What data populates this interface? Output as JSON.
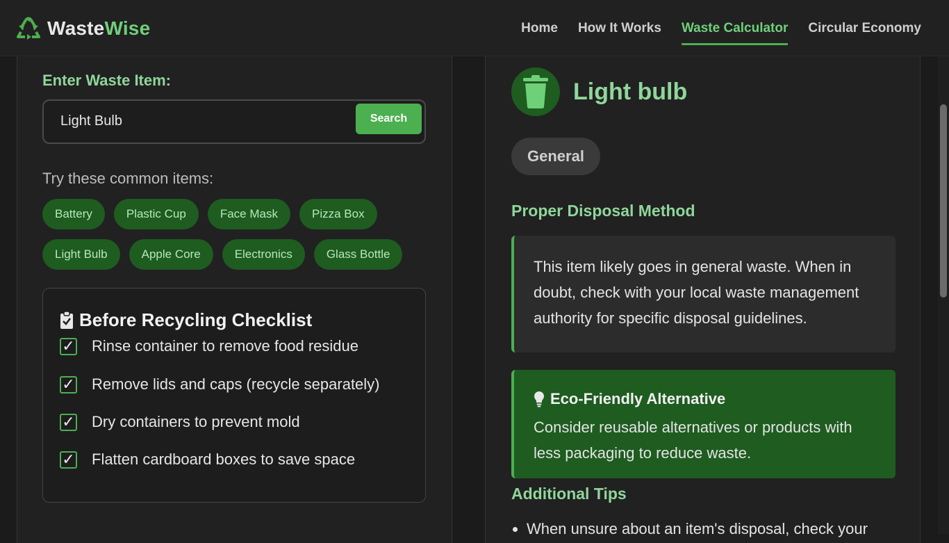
{
  "brand": {
    "name_part1": "Waste",
    "name_part2": "Wise"
  },
  "nav": {
    "items": [
      "Home",
      "How It Works",
      "Waste Calculator",
      "Circular Economy"
    ],
    "active": "Waste Calculator"
  },
  "search": {
    "label": "Enter Waste Item:",
    "value": "Light Bulb",
    "button": "Search"
  },
  "common": {
    "label": "Try these common items:",
    "rows": [
      [
        "Battery",
        "Plastic Cup",
        "Face Mask",
        "Pizza Box"
      ],
      [
        "Light Bulb",
        "Apple Core",
        "Electronics",
        "Glass Bottle"
      ]
    ]
  },
  "checklist": {
    "title": "Before Recycling Checklist",
    "check_mark": "✓",
    "items": [
      "Rinse container to remove food residue",
      "Remove lids and caps (recycle separately)",
      "Dry containers to prevent mold",
      "Flatten cardboard boxes to save space"
    ]
  },
  "result": {
    "title": "Light bulb",
    "category": "General",
    "disposal_heading": "Proper Disposal Method",
    "disposal_text": "This item likely goes in general waste. When in doubt, check with your local waste management authority for specific disposal guidelines.",
    "eco_title": "Eco-Friendly Alternative",
    "eco_text": "Consider reusable alternatives or products with less packaging to reduce waste.",
    "tips_heading": "Additional Tips",
    "tips": [
      "When unsure about an item's disposal, check your"
    ]
  },
  "icons": {
    "brand": "recycle-icon",
    "item": "trash-can-icon",
    "checklist": "clipboard-check-icon",
    "eco": "lightbulb-icon"
  },
  "colors": {
    "accent": "#4caf50",
    "accent_text": "#8fd69a",
    "chip_bg": "#1e5c20",
    "background": "#1b1b1b",
    "panel": "#212121"
  }
}
